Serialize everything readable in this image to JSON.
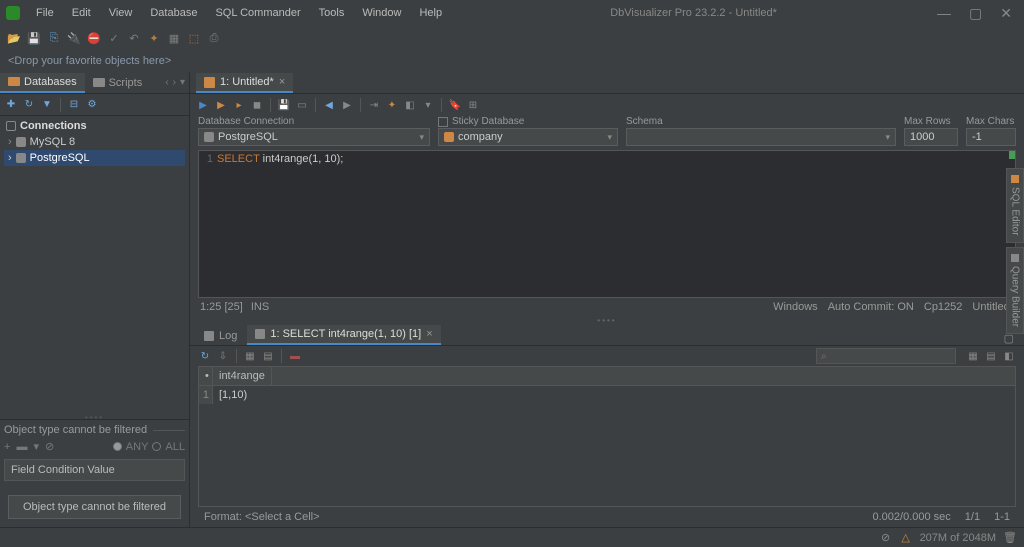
{
  "titlebar": {
    "title": "DbVisualizer Pro 23.2.2 - Untitled*"
  },
  "menu": {
    "file": "File",
    "edit": "Edit",
    "view": "View",
    "database": "Database",
    "sql_commander": "SQL Commander",
    "tools": "Tools",
    "window": "Window",
    "help": "Help"
  },
  "favorites_hint": "<Drop your favorite objects here>",
  "left": {
    "tab_databases": "Databases",
    "tab_scripts": "Scripts",
    "connections_label": "Connections",
    "nodes": [
      {
        "label": "MySQL 8"
      },
      {
        "label": "PostgreSQL"
      }
    ]
  },
  "filter": {
    "title": "Object type cannot be filtered",
    "any": "ANY",
    "all": "ALL",
    "header": "Field Condition Value",
    "button": "Object type cannot be filtered"
  },
  "editor": {
    "tab_label": "1: Untitled*",
    "conn_label": "Database Connection",
    "conn_value": "PostgreSQL",
    "sticky_label": "Sticky Database",
    "db_value": "company",
    "schema_label": "Schema",
    "maxrows_label": "Max Rows",
    "maxrows_value": "1000",
    "maxchars_label": "Max Chars",
    "maxchars_value": "-1",
    "line_num": "1",
    "sql_keyword": "SELECT",
    "sql_rest": " int4range(1, 10);",
    "status_pos": "1:25 [25]",
    "status_mode": "INS",
    "status_platform": "Windows",
    "status_autocommit": "Auto Commit: ON",
    "status_encoding": "Cp1252",
    "status_file": "Untitled*"
  },
  "results": {
    "tab_log": "Log",
    "tab_result": "1: SELECT int4range(1, 10) [1]",
    "col_header": "int4range",
    "row_num": "1",
    "cell_value": "[1,10)",
    "footer_format": "Format: <Select a Cell>",
    "footer_time": "0.002/0.000 sec",
    "footer_rows": "1/1",
    "footer_range": "1-1"
  },
  "rails": {
    "sql_editor": "SQL Editor",
    "query_builder": "Query Builder"
  },
  "statusbar": {
    "memory": "207M of 2048M"
  }
}
